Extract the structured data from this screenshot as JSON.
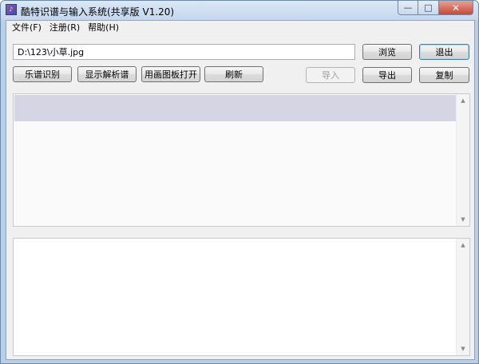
{
  "window": {
    "title": "酷特识谱与输入系统(共享版 V1.20)",
    "icon": "app-logo-icon",
    "caption": {
      "minimize": "—",
      "maximize": "□",
      "close": "✕"
    }
  },
  "menubar": {
    "items": [
      {
        "label": "文件(F)"
      },
      {
        "label": "注册(R)"
      },
      {
        "label": "帮助(H)"
      }
    ]
  },
  "path_field": {
    "value": "D:\\123\\小草.jpg"
  },
  "buttons": {
    "browse": "浏览",
    "exit": "退出",
    "recognize": "乐谱识别",
    "show_parse": "显示解析谱",
    "open_paint": "用画图板打开",
    "refresh": "刷新",
    "import": "导入",
    "export": "导出",
    "copy": "复制"
  },
  "colors": {
    "selection_row": "#d5d5e3",
    "default_button_border": "#3c7fb1",
    "close_button": "#c7483a"
  }
}
